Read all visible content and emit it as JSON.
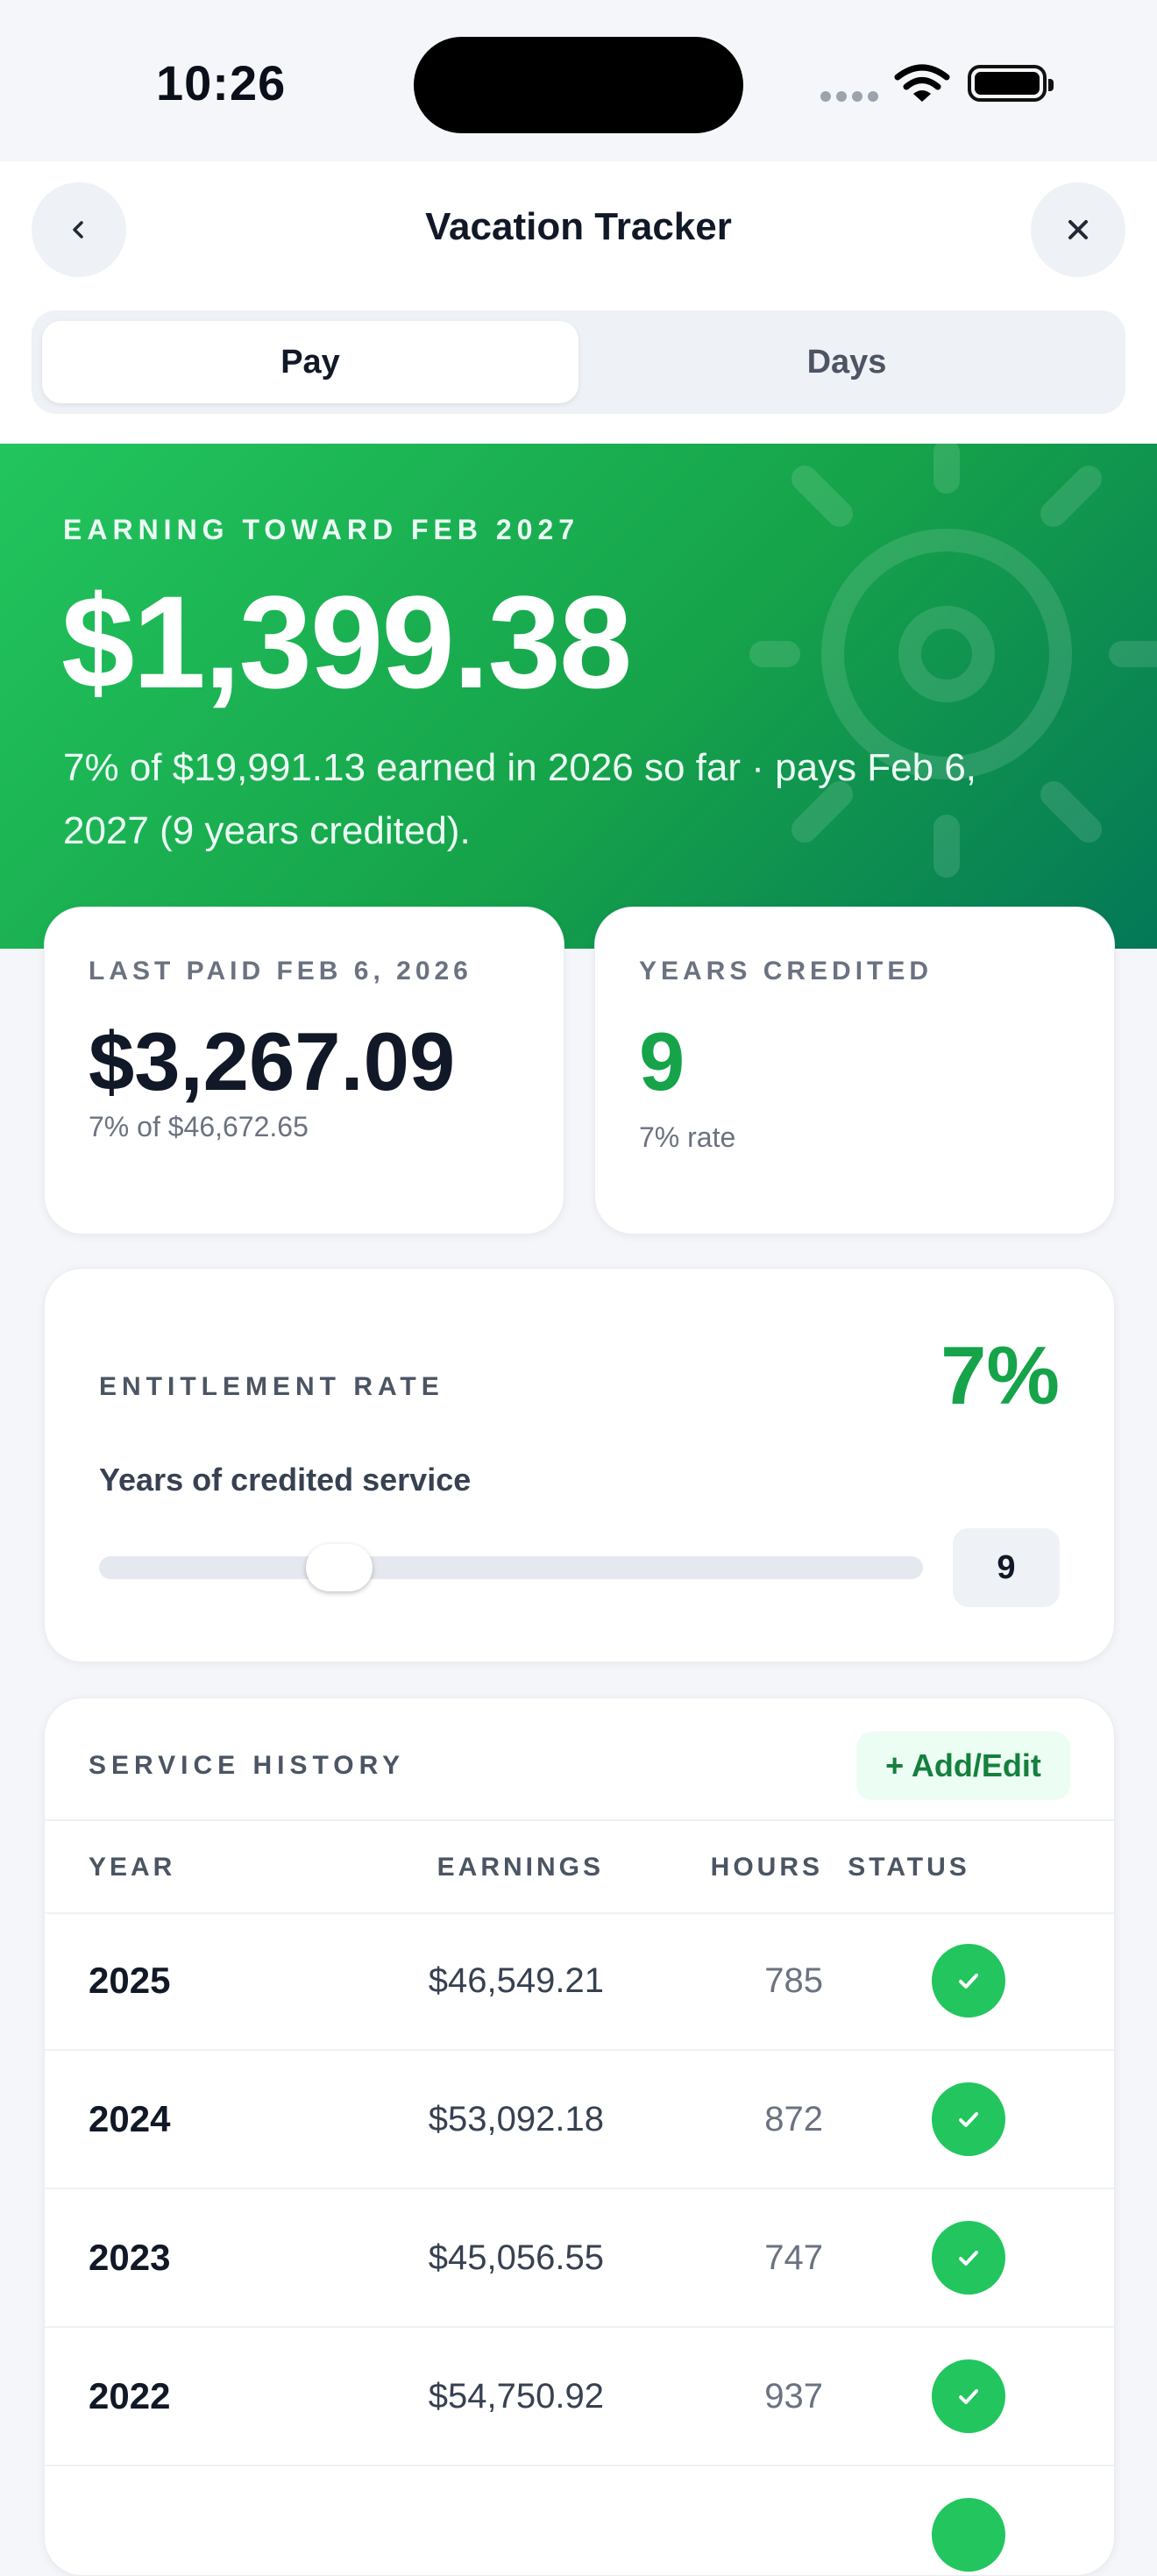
{
  "status_bar": {
    "time": "10:26"
  },
  "nav": {
    "title": "Vacation Tracker"
  },
  "tabs": [
    {
      "label": "Pay",
      "selected": true
    },
    {
      "label": "Days",
      "selected": false
    }
  ],
  "hero": {
    "label": "EARNING TOWARD FEB 2027",
    "amount": "$1,399.38",
    "description": "7% of $19,991.13 earned in 2026 so far · pays Feb 6, 2027 (9 years credited)."
  },
  "last_paid": {
    "label": "LAST PAID FEB 6, 2026",
    "value": "$3,267.09",
    "sub": "7% of $46,672.65"
  },
  "years_credited": {
    "label": "YEARS CREDITED",
    "value": "9",
    "sub": "7% rate"
  },
  "entitlement": {
    "label": "ENTITLEMENT RATE",
    "rate": "7%",
    "slider_label": "Years of credited service",
    "slider_value": "9"
  },
  "service_history": {
    "title": "SERVICE HISTORY",
    "add_label": "+ Add/Edit",
    "columns": [
      "YEAR",
      "EARNINGS",
      "HOURS",
      "STATUS"
    ],
    "rows": [
      {
        "year": "2025",
        "earnings": "$46,549.21",
        "hours": "785",
        "status": "check"
      },
      {
        "year": "2024",
        "earnings": "$53,092.18",
        "hours": "872",
        "status": "check"
      },
      {
        "year": "2023",
        "earnings": "$45,056.55",
        "hours": "747",
        "status": "check"
      },
      {
        "year": "2022",
        "earnings": "$54,750.92",
        "hours": "937",
        "status": "check"
      }
    ]
  },
  "colors": {
    "accent": "#16a34a",
    "hero_start": "#22c55e",
    "hero_end": "#047857"
  }
}
